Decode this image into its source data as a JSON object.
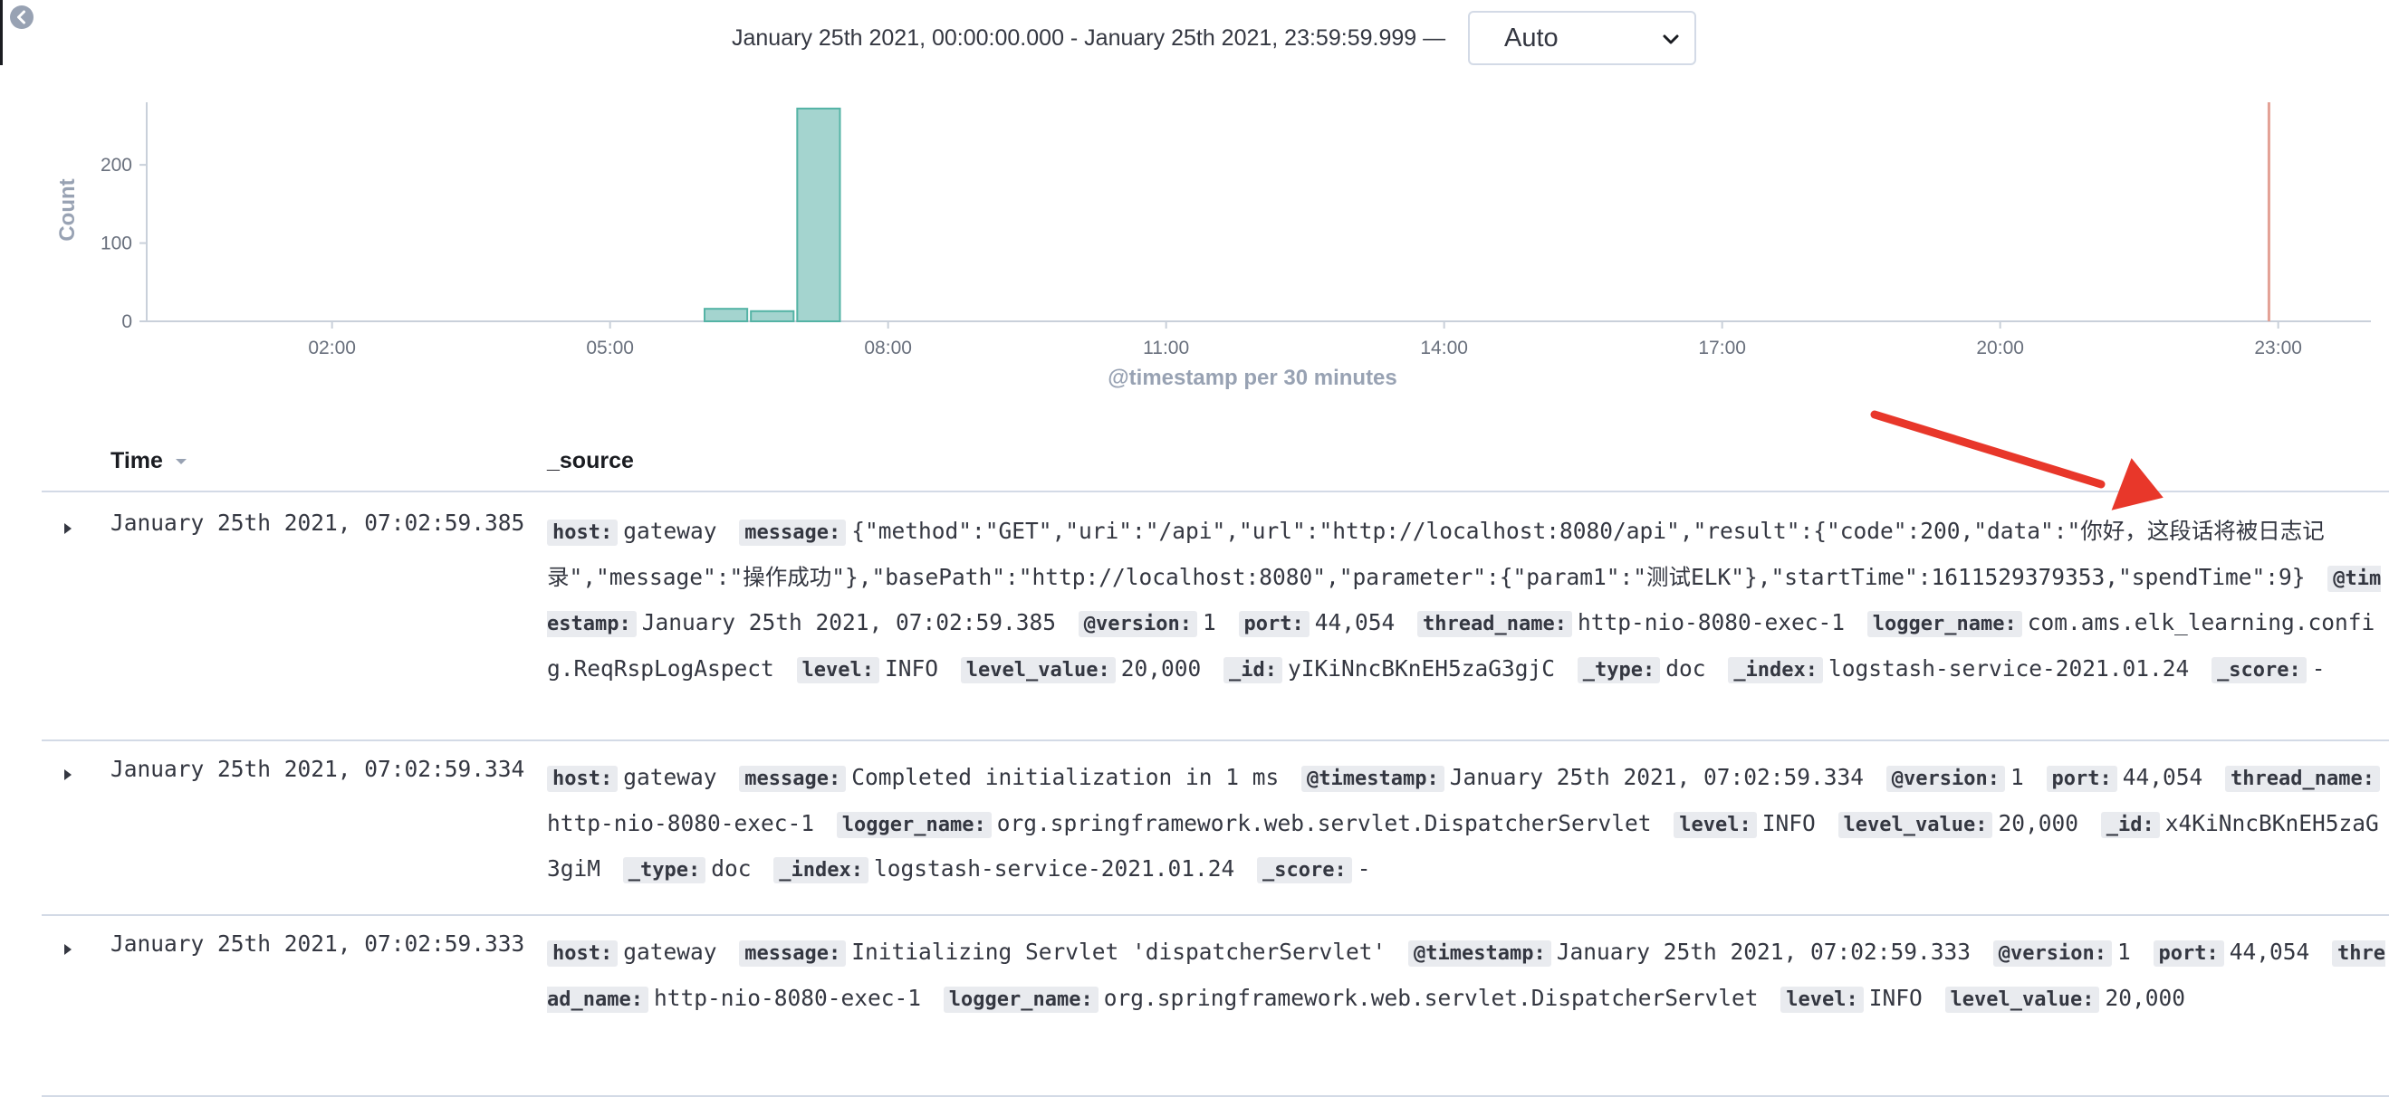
{
  "range_label": "January 25th 2021, 00:00:00.000 - January 25th 2021, 23:59:59.999 —",
  "interval": {
    "selected": "Auto"
  },
  "colors": {
    "bar": "#a4d4cf",
    "bar_stroke": "#54b3a5",
    "now_marker": "#e3a195",
    "arrow": "#e8372a"
  },
  "icons": {
    "back": "back-arrow-icon",
    "dropdown": "chevron-down-icon",
    "sort": "sort-down-icon",
    "expand": "caret-right-icon",
    "annotation": "red-arrow-annotation"
  },
  "chart_data": {
    "type": "bar",
    "title": "",
    "xlabel": "@timestamp per 30 minutes",
    "ylabel": "Count",
    "xlim": [
      "00:00",
      "24:00"
    ],
    "ylim": [
      0,
      280
    ],
    "x_ticks": [
      "02:00",
      "05:00",
      "08:00",
      "11:00",
      "14:00",
      "17:00",
      "20:00",
      "23:00"
    ],
    "y_ticks": [
      "0",
      "100",
      "200"
    ],
    "categories": [
      "06:00",
      "06:30",
      "07:00"
    ],
    "values": [
      16,
      13,
      272
    ],
    "now_marker": "22:54",
    "grid": false,
    "legend": "none"
  },
  "table": {
    "columns": {
      "time": "Time",
      "source": "_source"
    },
    "rows": [
      {
        "time": "January 25th 2021, 07:02:59.385",
        "fields": [
          {
            "k": "host:",
            "v": "gateway"
          },
          {
            "k": "message:",
            "v": "{\"method\":\"GET\",\"uri\":\"/api\",\"url\":\"http://localhost:8080/api\",\"result\":{\"code\":200,\"data\":\"你好，这段话将被日志记录\",\"message\":\"操作成功\"},\"basePath\":\"http://localhost:8080\",\"parameter\":{\"param1\":\"测试ELK\"},\"startTime\":1611529379353,\"spendTime\":9}"
          },
          {
            "k": "@timestamp:",
            "v": "January 25th 2021, 07:02:59.385"
          },
          {
            "k": "@version:",
            "v": "1"
          },
          {
            "k": "port:",
            "v": "44,054"
          },
          {
            "k": "thread_name:",
            "v": "http-nio-8080-exec-1"
          },
          {
            "k": "logger_name:",
            "v": "com.ams.elk_learning.config.ReqRspLogAspect"
          },
          {
            "k": "level:",
            "v": "INFO"
          },
          {
            "k": "level_value:",
            "v": "20,000"
          },
          {
            "k": "_id:",
            "v": "yIKiNncBKnEH5zaG3gjC"
          },
          {
            "k": "_type:",
            "v": "doc"
          },
          {
            "k": "_index:",
            "v": "logstash-service-2021.01.24"
          },
          {
            "k": "_score:",
            "v": "-"
          }
        ]
      },
      {
        "time": "January 25th 2021, 07:02:59.334",
        "fields": [
          {
            "k": "host:",
            "v": "gateway"
          },
          {
            "k": "message:",
            "v": "Completed initialization in 1 ms"
          },
          {
            "k": "@timestamp:",
            "v": "January 25th 2021, 07:02:59.334"
          },
          {
            "k": "@version:",
            "v": "1"
          },
          {
            "k": "port:",
            "v": "44,054"
          },
          {
            "k": "thread_name:",
            "v": "http-nio-8080-exec-1"
          },
          {
            "k": "logger_name:",
            "v": "org.springframework.web.servlet.DispatcherServlet"
          },
          {
            "k": "level:",
            "v": "INFO"
          },
          {
            "k": "level_value:",
            "v": "20,000"
          },
          {
            "k": "_id:",
            "v": "x4KiNncBKnEH5zaG3giM"
          },
          {
            "k": "_type:",
            "v": "doc"
          },
          {
            "k": "_index:",
            "v": "logstash-service-2021.01.24"
          },
          {
            "k": "_score:",
            "v": "-"
          }
        ]
      },
      {
        "time": "January 25th 2021, 07:02:59.333",
        "fields": [
          {
            "k": "host:",
            "v": "gateway"
          },
          {
            "k": "message:",
            "v": "Initializing Servlet 'dispatcherServlet'"
          },
          {
            "k": "@timestamp:",
            "v": "January 25th 2021, 07:02:59.333"
          },
          {
            "k": "@version:",
            "v": "1"
          },
          {
            "k": "port:",
            "v": "44,054"
          },
          {
            "k": "thread_name:",
            "v": "http-nio-8080-exec-1"
          },
          {
            "k": "logger_name:",
            "v": "org.springframework.web.servlet.DispatcherServlet"
          },
          {
            "k": "level:",
            "v": "INFO"
          },
          {
            "k": "level_value:",
            "v": "20,000"
          }
        ]
      }
    ]
  }
}
